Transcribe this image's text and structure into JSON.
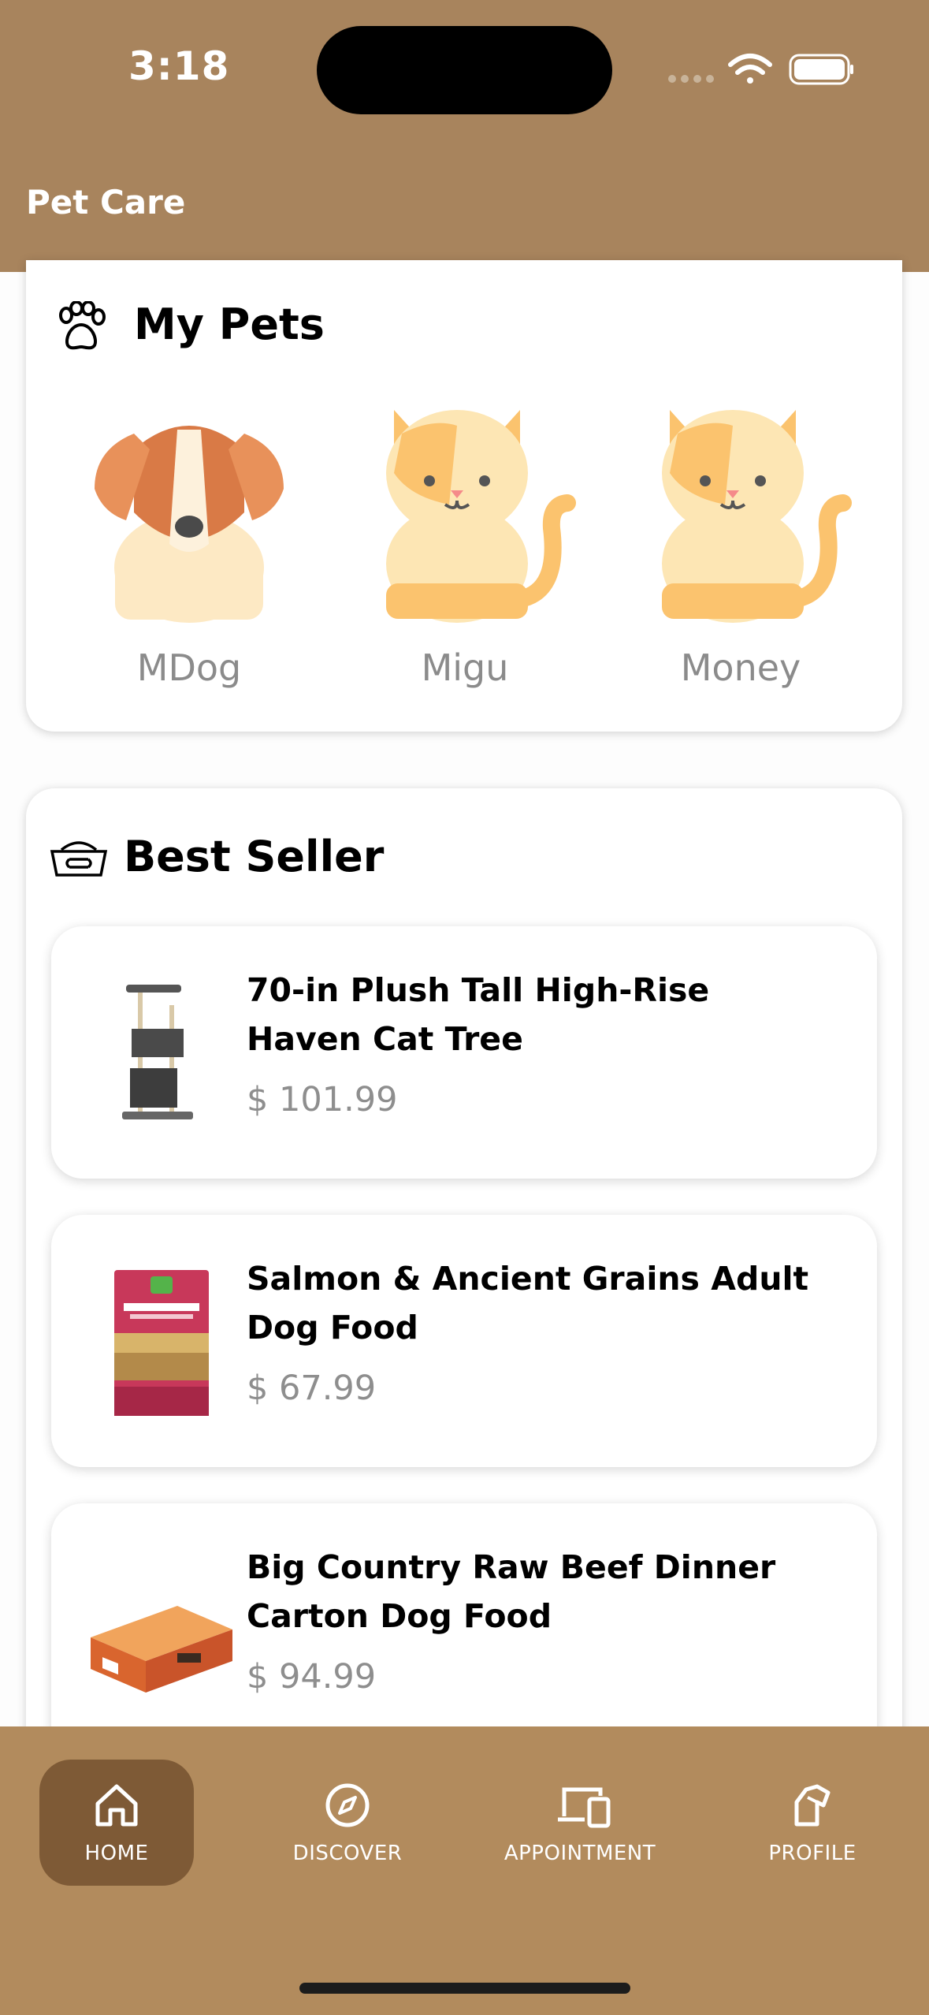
{
  "status_bar": {
    "time": "3:18"
  },
  "header": {
    "title": "Pet Care"
  },
  "my_pets": {
    "title": "My Pets",
    "pets": [
      {
        "name": "MDog",
        "icon": "dog-icon"
      },
      {
        "name": "Migu",
        "icon": "cat-icon"
      },
      {
        "name": "Money",
        "icon": "cat-icon"
      }
    ]
  },
  "best_seller": {
    "title": "Best Seller",
    "products": [
      {
        "name": "70-in Plush Tall High-Rise Haven Cat Tree",
        "price": "$ 101.99",
        "image": "cat-tree-image"
      },
      {
        "name": "Salmon & Ancient Grains Adult Dog Food",
        "price": "$ 67.99",
        "image": "dog-food-bag-image"
      },
      {
        "name": "Big Country Raw Beef Dinner Carton Dog Food",
        "price": "$ 94.99",
        "image": "dog-food-carton-image"
      }
    ]
  },
  "bottom_nav": {
    "active": "HOME",
    "items": [
      {
        "label": "HOME",
        "icon": "home-icon"
      },
      {
        "label": "DISCOVER",
        "icon": "compass-icon"
      },
      {
        "label": "APPOINTMENT",
        "icon": "devices-icon"
      },
      {
        "label": "PROFILE",
        "icon": "profile-icon"
      }
    ]
  },
  "colors": {
    "header": "#a8845d",
    "bottom_bar": "#b28b5d",
    "nav_active": "#7e5a36",
    "muted_text": "#8b8b8b"
  }
}
